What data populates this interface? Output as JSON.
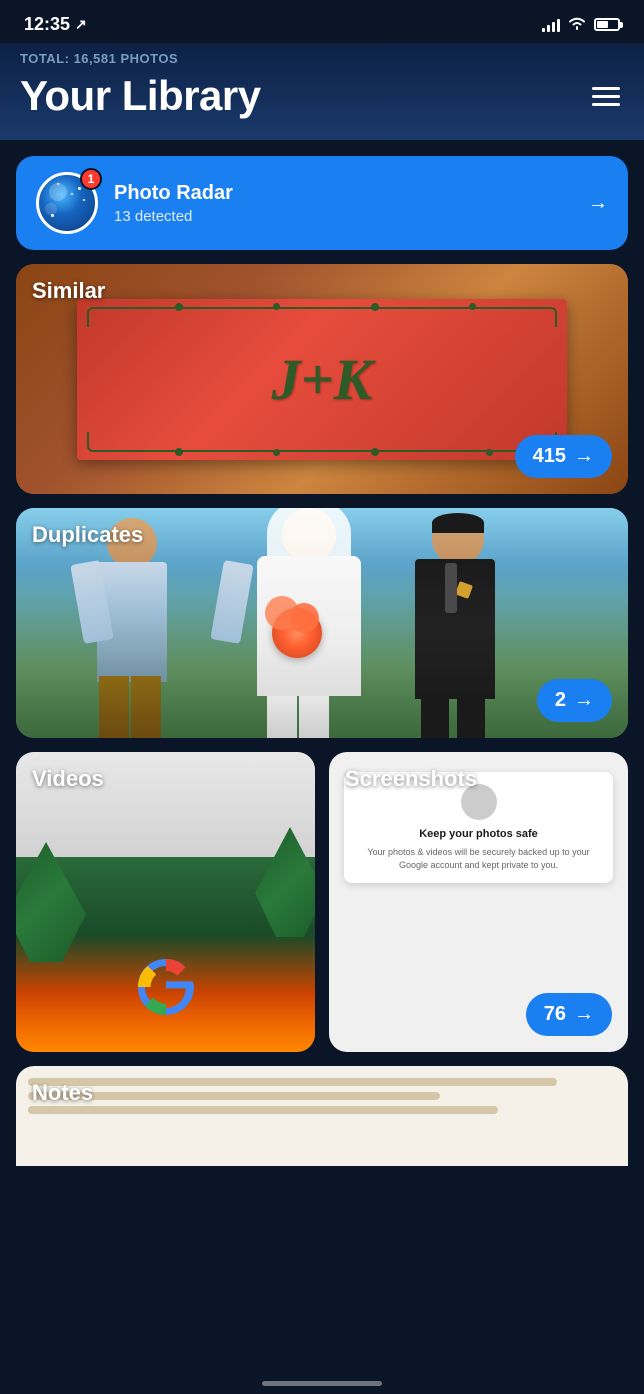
{
  "statusBar": {
    "time": "12:35",
    "locationArrow": "↗"
  },
  "header": {
    "totalLabel": "TOTAL: 16,581 PHOTOS",
    "title": "Your Library",
    "menuLabel": "Menu"
  },
  "radarBanner": {
    "badge": "1",
    "title": "Photo Radar",
    "subtitle": "13 detected",
    "arrow": "→"
  },
  "similar": {
    "label": "Similar",
    "count": "415",
    "arrow": "→"
  },
  "duplicates": {
    "label": "Duplicates",
    "count": "2",
    "arrow": "→"
  },
  "videos": {
    "label": "Videos"
  },
  "screenshots": {
    "label": "Screenshots",
    "mockTitle": "Keep your photos safe",
    "mockBody": "Your photos & videos will be securely backed up to your Google account and kept private to you.",
    "count": "76",
    "arrow": "→"
  },
  "notes": {
    "label": "Notes"
  }
}
